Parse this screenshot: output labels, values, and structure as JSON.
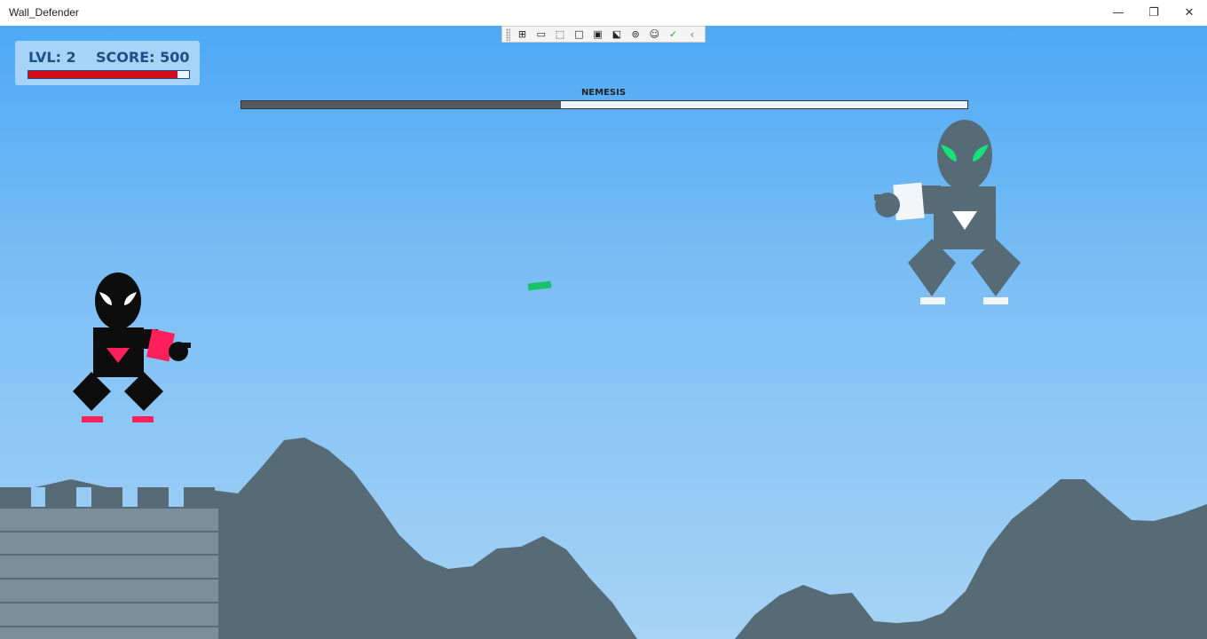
{
  "window": {
    "title": "Wall_Defender",
    "minimize_glyph": "—",
    "maximize_glyph": "❐",
    "close_glyph": "✕"
  },
  "hud": {
    "level_text": "LVL: 2",
    "score_text": "SCORE: 500",
    "player_health_fraction": 0.93
  },
  "boss": {
    "name": "NEMESIS",
    "health_fraction": 0.44
  },
  "toolbar": {
    "buttons": [
      {
        "icon": "live-visual-tree-icon",
        "glyph": "⊞"
      },
      {
        "icon": "video-camera-icon",
        "glyph": "▭"
      },
      {
        "icon": "select-element-icon",
        "glyph": "⬚"
      },
      {
        "icon": "display-layout-adorners-icon",
        "glyph": "□"
      },
      {
        "icon": "track-focus-icon",
        "glyph": "▣"
      },
      {
        "icon": "preview-selection-icon",
        "glyph": "⬕"
      },
      {
        "icon": "binding-failures-icon",
        "glyph": "⊚"
      },
      {
        "icon": "accessibility-icon",
        "glyph": "☺"
      },
      {
        "icon": "checkmark-icon",
        "glyph": "✓"
      },
      {
        "icon": "collapse-chevron-icon",
        "glyph": "‹"
      }
    ]
  },
  "colors": {
    "sky_top": "#4fa9f5",
    "sky_bottom": "#a6d3f5",
    "mountain": "#566b76",
    "wall": "#7a8f9b",
    "player_body": "#0d0d0d",
    "player_accent": "#ff1f5a",
    "enemy_body": "#566b76",
    "enemy_eye": "#18e07a",
    "projectile": "#19c16b",
    "hud_text": "#1c4f86",
    "health_red": "#d40a16"
  }
}
